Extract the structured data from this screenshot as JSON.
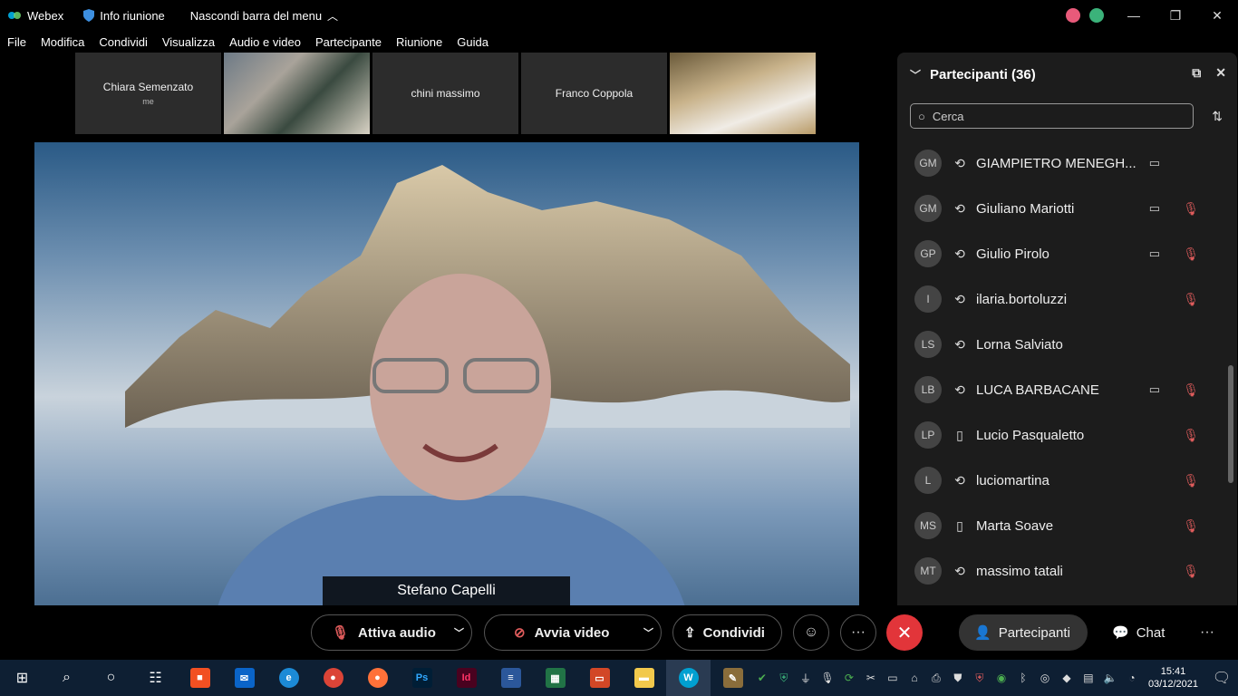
{
  "titlebar": {
    "app_name": "Webex",
    "info_label": "Info riunione",
    "hide_label": "Nascondi barra del menu"
  },
  "menu": [
    "File",
    "Modifica",
    "Condividi",
    "Visualizza",
    "Audio e video",
    "Partecipante",
    "Riunione",
    "Guida"
  ],
  "thumbnails": [
    {
      "name": "Chiara Semenzato",
      "sub": "me"
    },
    {
      "name": ""
    },
    {
      "name": "chini massimo"
    },
    {
      "name": "Franco Coppola"
    },
    {
      "name": ""
    }
  ],
  "active_speaker": "Stefano Capelli",
  "panel": {
    "title": "Partecipanti (36)",
    "search_placeholder": "Cerca",
    "participants": [
      {
        "initials": "GM",
        "name": "GIAMPIETRO MENEGH...",
        "device": "sync-icon",
        "video": true,
        "muted": false
      },
      {
        "initials": "GM",
        "name": "Giuliano Mariotti",
        "device": "sync-icon",
        "video": true,
        "muted": true
      },
      {
        "initials": "GP",
        "name": "Giulio Pirolo",
        "device": "sync-icon",
        "video": true,
        "muted": true
      },
      {
        "initials": "I",
        "name": "ilaria.bortoluzzi",
        "device": "sync-icon",
        "video": false,
        "muted": true
      },
      {
        "initials": "LS",
        "name": "Lorna Salviato",
        "device": "sync-icon",
        "video": false,
        "muted": false
      },
      {
        "initials": "LB",
        "name": "LUCA BARBACANE",
        "device": "sync-icon",
        "video": true,
        "muted": true
      },
      {
        "initials": "LP",
        "name": "Lucio Pasqualetto",
        "device": "phone-icon",
        "video": false,
        "muted": true
      },
      {
        "initials": "L",
        "name": "luciomartina",
        "device": "sync-icon",
        "video": false,
        "muted": true
      },
      {
        "initials": "MS",
        "name": "Marta Soave",
        "device": "phone-icon",
        "video": false,
        "muted": true
      },
      {
        "initials": "MT",
        "name": "massimo tatali",
        "device": "sync-icon",
        "video": false,
        "muted": true
      }
    ]
  },
  "controls": {
    "audio_label": "Attiva audio",
    "video_label": "Avvia video",
    "share_label": "Condividi",
    "participants_label": "Partecipanti",
    "chat_label": "Chat"
  },
  "taskbar": {
    "time": "15:41",
    "date": "03/12/2021",
    "ps_label": "Ps",
    "id_label": "Id"
  },
  "colors": {
    "end_button": "#e2353a",
    "mute_red": "#e05c5c",
    "panel_bg": "#1c1c1c",
    "taskbar_bg": "#0e1f33"
  }
}
